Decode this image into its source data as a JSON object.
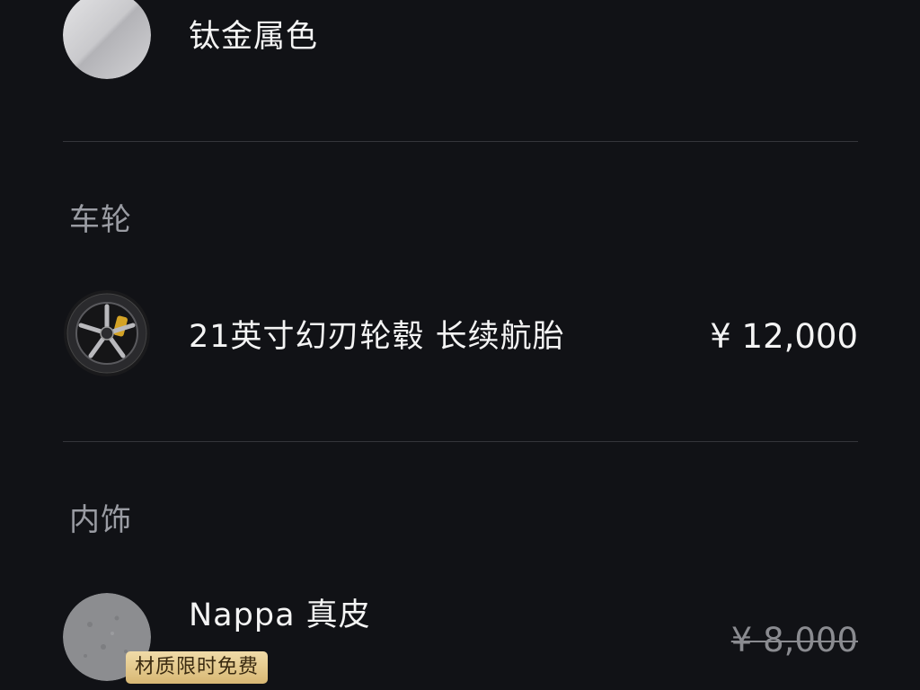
{
  "color_option": {
    "name": "钛金属色"
  },
  "wheels": {
    "section_title": "车轮",
    "option_name": "21英寸幻刃轮毂 长续航胎",
    "price": "¥ 12,000"
  },
  "interior": {
    "section_title": "内饰",
    "option_name": "Nappa 真皮",
    "badge": "材质限时免费",
    "price": "¥ 8,000",
    "badge_color": "#d8b874"
  },
  "colors": {
    "background": "#111216",
    "divider": "#34353a",
    "section_title": "#9a9ca3",
    "strike_price": "#8a8b90"
  },
  "icons": {
    "color_swatch": "titanium-swatch-icon",
    "wheel": "wheel-icon",
    "leather": "nappa-leather-swatch-icon"
  }
}
